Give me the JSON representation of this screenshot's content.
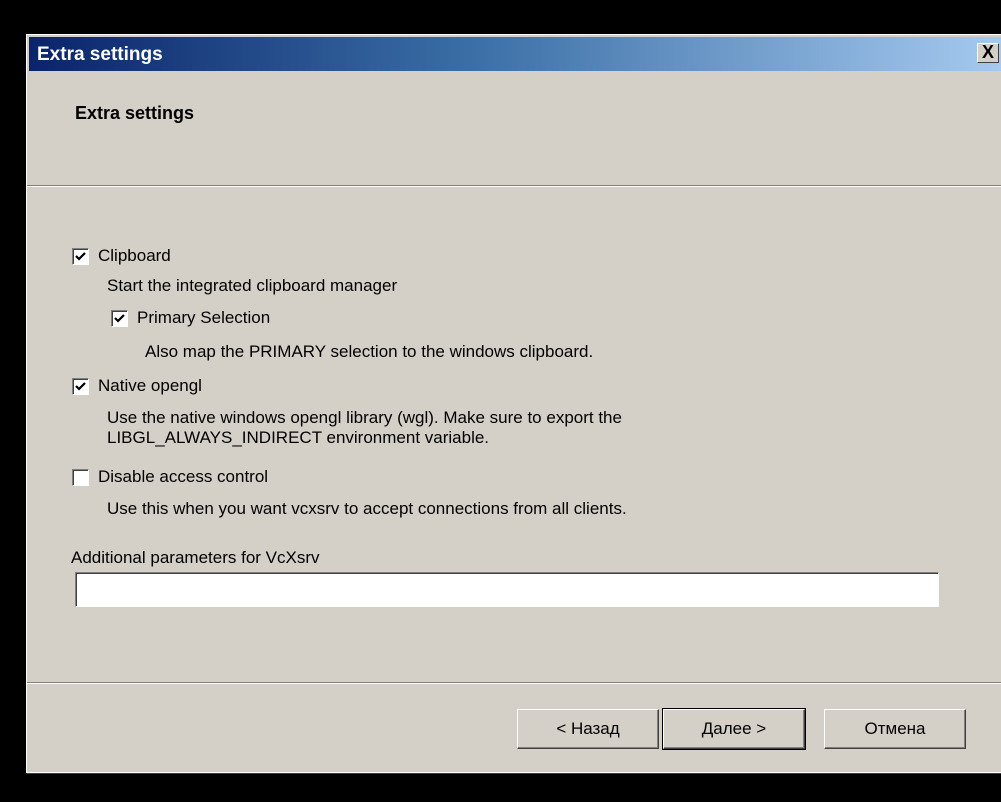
{
  "window": {
    "title": "Extra settings",
    "close_glyph": "X"
  },
  "header": {
    "title": "Extra settings"
  },
  "options": {
    "clipboard": {
      "label": "Clipboard",
      "checked": true,
      "description": "Start the integrated clipboard manager"
    },
    "primary_selection": {
      "label": "Primary Selection",
      "checked": true,
      "description": "Also map the PRIMARY selection to the windows clipboard."
    },
    "native_opengl": {
      "label": "Native opengl",
      "checked": true,
      "description_line1": "Use the native windows opengl library (wgl). Make sure to export the",
      "description_line2": "LIBGL_ALWAYS_INDIRECT environment variable."
    },
    "disable_access_control": {
      "label": "Disable access control",
      "checked": false,
      "description": "Use this when you want vcxsrv to accept connections from all clients."
    }
  },
  "additional_params": {
    "label": "Additional parameters for VcXsrv",
    "value": ""
  },
  "buttons": {
    "back": "< Назад",
    "next": "Далее >",
    "cancel": "Отмена"
  },
  "colors": {
    "dialog_bg": "#d4d0c8",
    "titlebar_start": "#0a246a",
    "titlebar_end": "#a6caf0"
  }
}
